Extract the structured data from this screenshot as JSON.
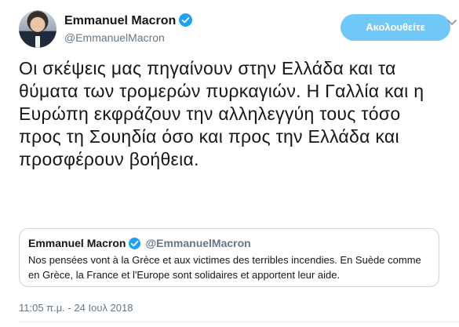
{
  "tweet": {
    "author": {
      "name": "Emmanuel Macron",
      "handle": "@EmmanuelMacron",
      "verified_icon": "verified-badge-icon"
    },
    "follow_button_label": "Ακολουθείτε",
    "more_icon": "chevron-down-icon",
    "text": "Οι σκέψεις μας πηγαίνουν στην Ελλάδα και τα θύματα των τρομερών πυρκαγιών. Η Γαλλία και η Ευρώπη εκφράζουν την αλληλεγγύη τους τόσο προς τη Σουηδία όσο και προς την Ελλάδα και προσφέρουν βοήθεια.",
    "quoted": {
      "name": "Emmanuel Macron",
      "handle": "@EmmanuelMacron",
      "text": "Nos pensées vont à la Grèce et aux victimes des terribles incendies. En Suède comme en Grèce, la France et l'Europe sont solidaires et apportent leur aide."
    },
    "timestamp": "11:05 π.μ. - 24 Ιουλ 2018"
  },
  "colors": {
    "accent": "#1da1f2",
    "follow_button": "#71c9f8",
    "secondary_text": "#657786",
    "border": "#ccd6dd"
  }
}
